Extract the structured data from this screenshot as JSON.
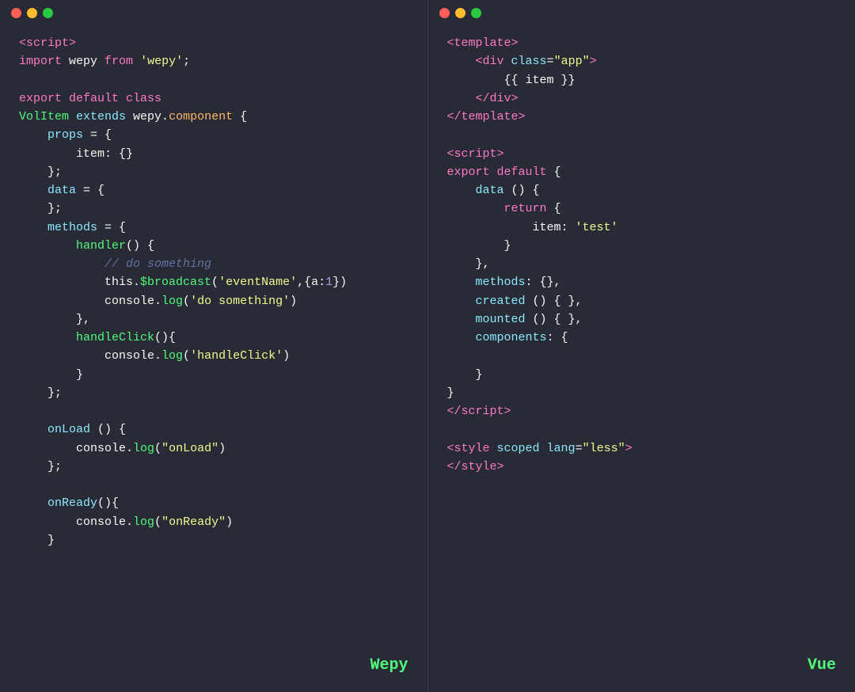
{
  "left_panel": {
    "label": "Wepy",
    "titlebar": {
      "dots": [
        "red",
        "yellow",
        "green"
      ]
    }
  },
  "right_panel": {
    "label": "Vue",
    "titlebar": {
      "dots": [
        "red",
        "yellow",
        "green"
      ]
    }
  }
}
